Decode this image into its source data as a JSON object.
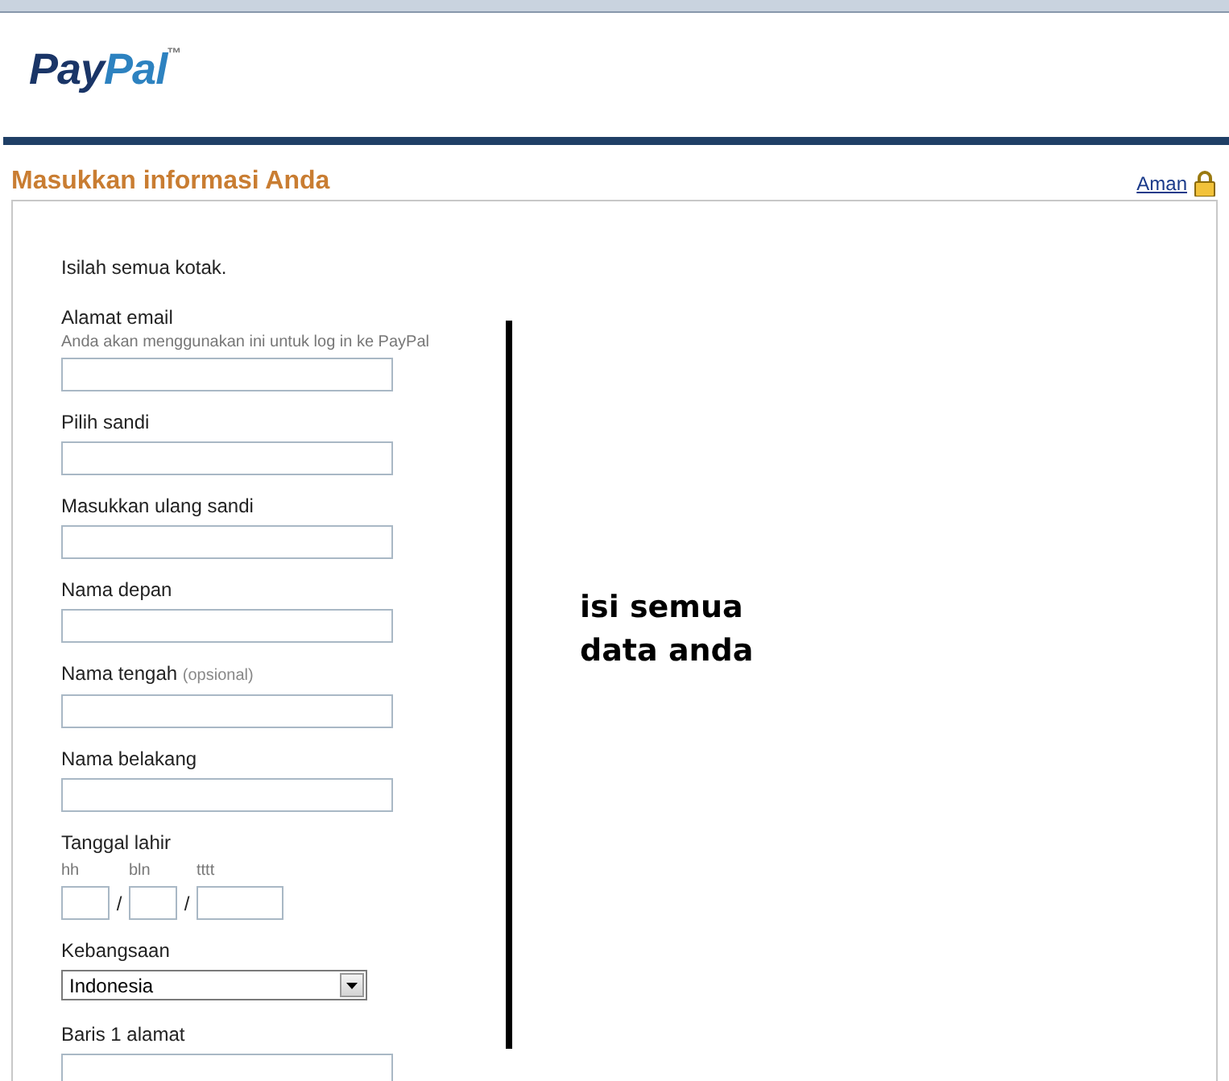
{
  "header": {
    "logo": {
      "first": "Pay",
      "second": "Pal",
      "mark": "™"
    }
  },
  "section": {
    "title": "Masukkan informasi Anda",
    "secure_link": "Aman"
  },
  "form": {
    "intro": "Isilah semua kotak.",
    "fields": [
      {
        "kind": "text",
        "label": "Alamat email",
        "hint": "Anda akan menggunakan ini untuk log in ke PayPal"
      },
      {
        "kind": "text",
        "label": "Pilih sandi"
      },
      {
        "kind": "text",
        "label": "Masukkan ulang sandi"
      },
      {
        "kind": "text",
        "label": "Nama depan"
      },
      {
        "kind": "text",
        "label": "Nama tengah",
        "note": "(opsional)"
      },
      {
        "kind": "text",
        "label": "Nama belakang"
      },
      {
        "kind": "date",
        "label": "Tanggal lahir",
        "parts": [
          {
            "caption": "hh",
            "separator": "/"
          },
          {
            "caption": "bln",
            "separator": "/"
          },
          {
            "caption": "tttt"
          }
        ]
      },
      {
        "kind": "select",
        "label": "Kebangsaan",
        "value": "Indonesia"
      },
      {
        "kind": "text",
        "label": "Baris 1 alamat"
      }
    ]
  },
  "annotation": {
    "lines": [
      "isi semua",
      "data anda"
    ]
  }
}
